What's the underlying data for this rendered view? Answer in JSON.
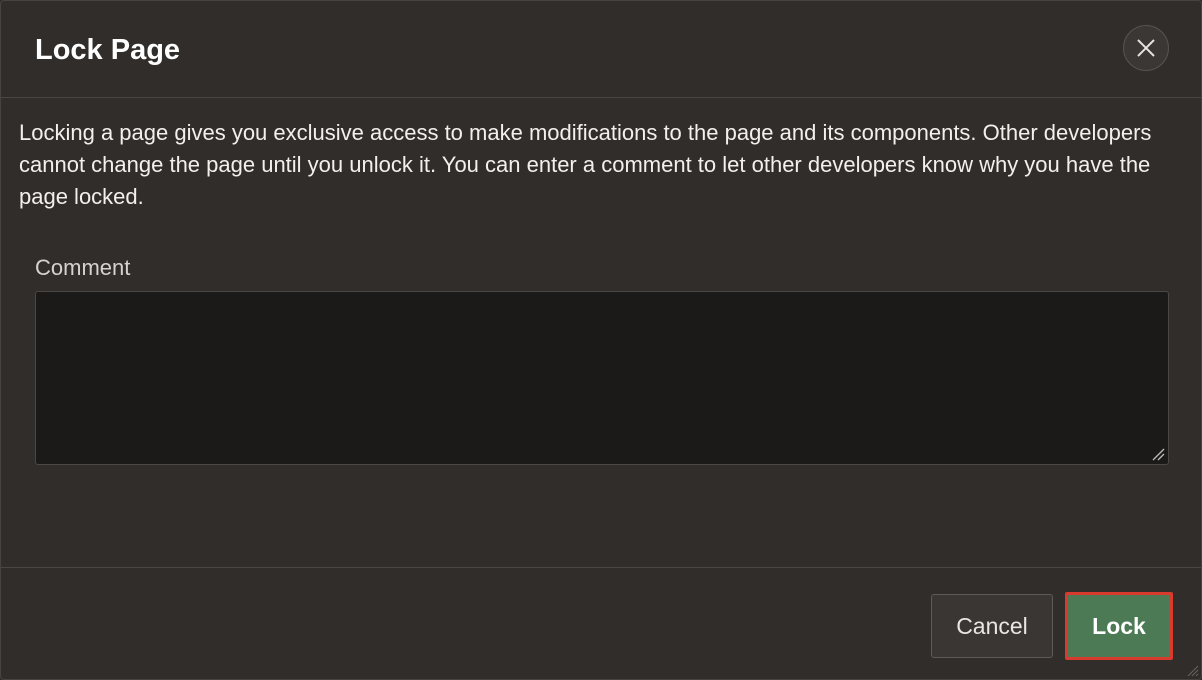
{
  "dialog": {
    "title": "Lock Page",
    "close_icon": "close-icon",
    "description": "Locking a page gives you exclusive access to make modifications to the page and its components. Other developers cannot change the page until you unlock it. You can enter a comment to let other developers know why you have the page locked."
  },
  "form": {
    "comment_label": "Comment",
    "comment_value": "",
    "resize_icon": "resize-grip-icon"
  },
  "footer": {
    "cancel_label": "Cancel",
    "lock_label": "Lock"
  },
  "colors": {
    "background": "#312d2a",
    "input_background": "#1b1a19",
    "primary_button": "#4b7a55",
    "highlight_border": "#d93a2e"
  }
}
